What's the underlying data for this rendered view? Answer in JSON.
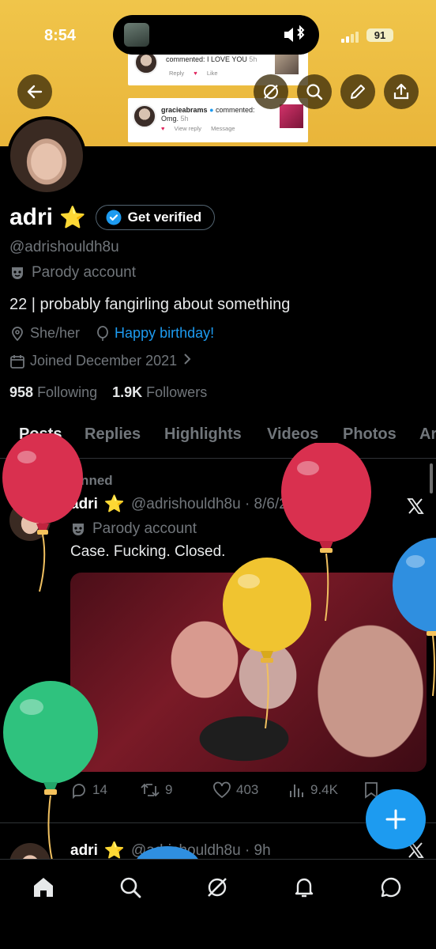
{
  "status_bar": {
    "time": "8:54",
    "battery": "91"
  },
  "banner": {
    "card_top": {
      "text": "commented: I LOVE YOU",
      "time": "5h",
      "reply": "Reply",
      "like": "Like"
    },
    "card_bottom": {
      "user": "gracieabrams",
      "text": "commented:",
      "comment": "Omg.",
      "time": "5h",
      "view_reply": "View reply",
      "message": "Message"
    }
  },
  "header_actions": {
    "back": "back-arrow-icon",
    "grok": "grok-icon",
    "search": "search-icon",
    "edit": "pencil-icon",
    "share": "share-icon"
  },
  "profile": {
    "name": "adri",
    "star": "⭐",
    "verify_label": "Get verified",
    "handle": "@adrishouldh8u",
    "parody_label": "Parody account",
    "bio": "22 | probably fangirling about something",
    "pronouns": "She/her",
    "birthday": "Happy birthday!",
    "joined": "Joined December 2021",
    "following_count": "958",
    "following_label": "Following",
    "followers_count": "1.9K",
    "followers_label": "Followers"
  },
  "tabs": [
    "Posts",
    "Replies",
    "Highlights",
    "Videos",
    "Photos",
    "Ar"
  ],
  "pinned_post": {
    "pinned_label": "Pinned",
    "name": "adri",
    "star": "⭐",
    "handle_date": "@adrishouldh8u · 8/6/25",
    "parody_label": "Parody account",
    "text": "Case. Fucking. Closed.",
    "replies": "14",
    "reposts": "9",
    "likes": "403",
    "views": "9.4K"
  },
  "next_post": {
    "name": "adri",
    "star": "⭐",
    "handle_time": "@adrishouldh8u · 9h"
  },
  "colors": {
    "accent": "#1d9bf0",
    "banner": "#e9b53a",
    "balloon_red": "#d9304f",
    "balloon_yellow": "#f0c430",
    "balloon_green": "#2fc27e",
    "balloon_blue": "#2f8fe0"
  }
}
